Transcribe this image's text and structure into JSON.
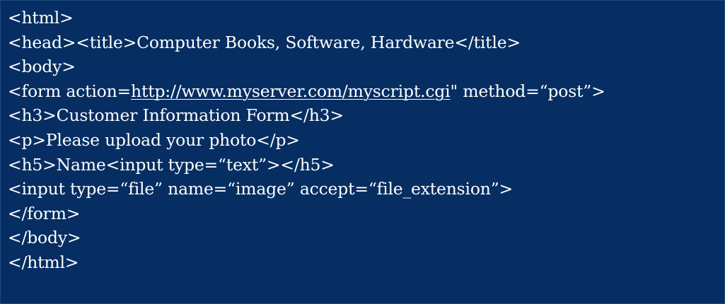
{
  "colors": {
    "background": "#062e62",
    "text": "#ffffff"
  },
  "code": {
    "line1": "<html>",
    "line2": "<head><title>Computer Books, Software, Hardware</title>",
    "line3": "<body>",
    "line4_prefix": "<form action=",
    "line4_link": "http://www.myserver.com/myscript.cgi",
    "line4_suffix": "\" method=“post”>",
    "line5": "<h3>Customer Information Form</h3>",
    "line6": "<p>Please upload your photo</p>",
    "line7": "<h5>Name<input type=“text”></h5>",
    "line8": "<input type=“file” name=“image” accept=“file_extension”>",
    "line9": "</form>",
    "line10": "</body>",
    "line11": "</html>"
  }
}
